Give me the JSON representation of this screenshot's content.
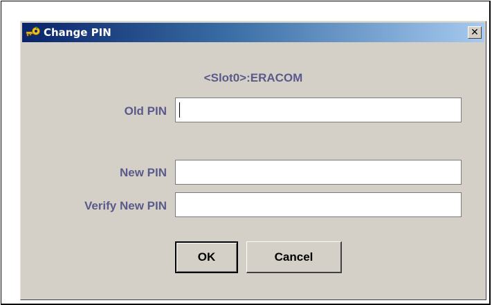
{
  "window": {
    "title": "Change PIN",
    "icon": "key-icon",
    "close_label": "✕"
  },
  "slot_label": "<Slot0>:ERACOM",
  "fields": {
    "old_pin": {
      "label": "Old PIN",
      "value": ""
    },
    "new_pin": {
      "label": "New PIN",
      "value": ""
    },
    "verify_new_pin": {
      "label": "Verify New PIN",
      "value": ""
    }
  },
  "buttons": {
    "ok": "OK",
    "cancel": "Cancel"
  },
  "colors": {
    "title_gradient_start": "#0a246a",
    "title_gradient_end": "#a6caf0",
    "label": "#5a5a8a",
    "dialog_bg": "#d4d0c8"
  }
}
